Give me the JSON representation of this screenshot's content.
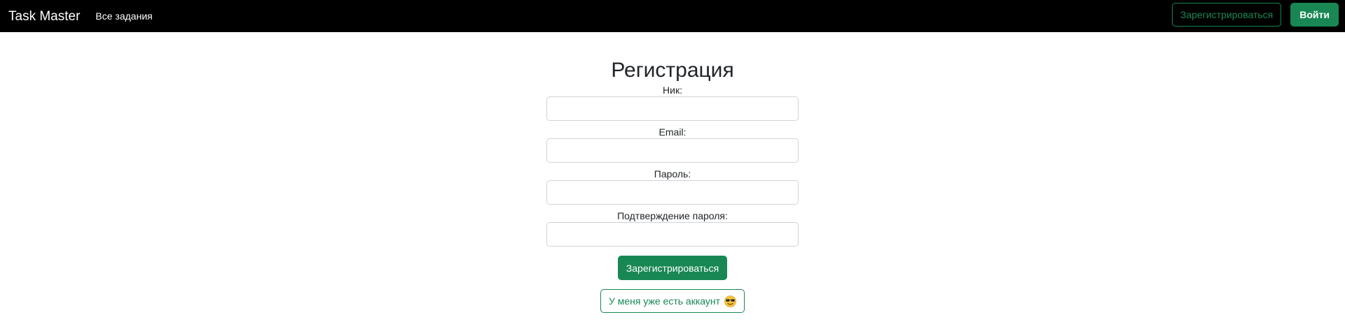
{
  "navbar": {
    "brand": "Task Master",
    "links": [
      {
        "label": "Все задания"
      }
    ],
    "register_label": "Зарегистрироваться",
    "login_label": "Войти",
    "accent_color": "#198754"
  },
  "form": {
    "title": "Регистрация",
    "fields": [
      {
        "label": "Ник:",
        "value": ""
      },
      {
        "label": "Email:",
        "value": ""
      },
      {
        "label": "Пароль:",
        "value": ""
      },
      {
        "label": "Подтверждение пароля:",
        "value": ""
      }
    ],
    "submit_label": "Зарегистрироваться",
    "have_account_label": "У меня уже есть аккаунт",
    "have_account_icon": "sunglasses-emoji-icon"
  }
}
